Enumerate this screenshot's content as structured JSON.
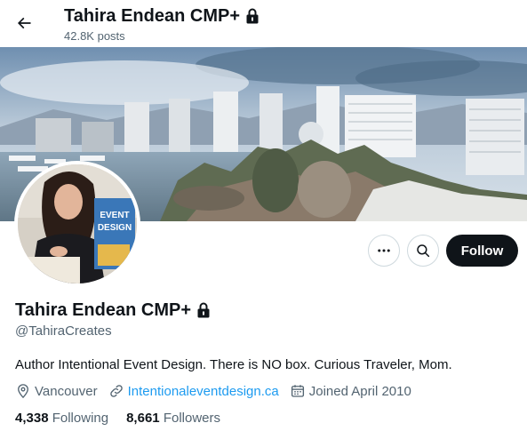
{
  "header": {
    "name": "Tahira Endean CMP+",
    "posts": "42.8K posts",
    "back_icon": "arrow-left-icon",
    "lock_icon": "lock-icon"
  },
  "actions": {
    "more_icon": "more-horizontal-icon",
    "search_icon": "search-icon",
    "follow_label": "Follow"
  },
  "profile": {
    "name": "Tahira Endean CMP+",
    "handle": "@TahiraCreates",
    "bio": "Author Intentional Event Design. There is NO box. Curious Traveler, Mom.",
    "location": "Vancouver",
    "website": "Intentionaleventdesign.ca",
    "joined": "Joined April 2010"
  },
  "stats": {
    "following_count": "4,338",
    "following_label": "Following",
    "followers_count": "8,661",
    "followers_label": "Followers"
  },
  "avatar_book": {
    "line1": "EVENT",
    "line2": "DESIGN"
  },
  "colors": {
    "text": "#0f1419",
    "secondary": "#536471",
    "link": "#1d9bf0",
    "follow_bg": "#0f1419",
    "border": "#cfd9de"
  }
}
